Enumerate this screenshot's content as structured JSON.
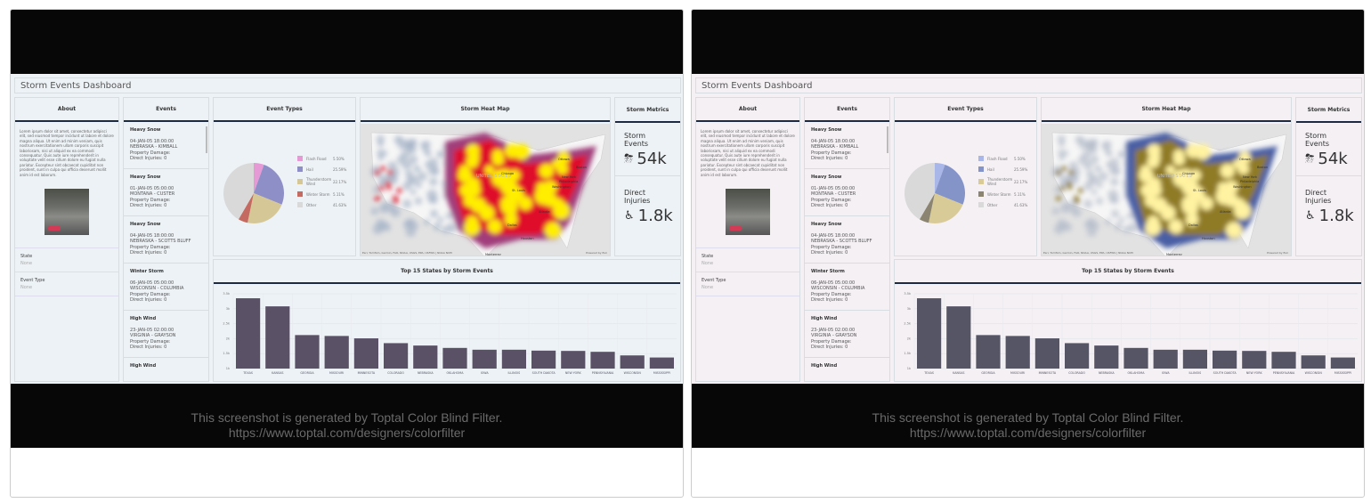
{
  "caption": {
    "line1": "This screenshot is generated by Toptal Color Blind Filter.",
    "line2": "https://www.toptal.com/designers/colorfilter"
  },
  "dashboard": {
    "title": "Storm Events Dashboard",
    "about": {
      "header": "About",
      "text": "Lorem ipsum dolor sit amet, consectetur adipisci elit, sed eiusmod tempor incidunt ut labore et dolore magna aliqua. Ut enim ad minim veniam, quis nostrum exercitationem ullam corporis suscipit laboriosam, nisi ut aliquid ex ea commodi consequatur. Quis aute iure reprehenderit in voluptate velit esse cillum dolore eu fugiat nulla pariatur. Excepteur sint obcaecat cupiditat non proident, sunt in culpa qui officia deserunt mollit anim id est laborum.",
      "state_label": "State",
      "state_value": "None",
      "type_label": "Event Type",
      "type_value": "None"
    },
    "events": {
      "header": "Events",
      "items": [
        {
          "type": "Heavy Snow",
          "date": "04-JAN-05 18:00:00",
          "loc": "NEBRASKA - KIMBALL",
          "damage": "Property Damage:",
          "injuries": "Direct Injuries: 0"
        },
        {
          "type": "Heavy Snow",
          "date": "01-JAN-05 05:00:00",
          "loc": "MONTANA - CUSTER",
          "damage": "Property Damage:",
          "injuries": "Direct Injuries: 0"
        },
        {
          "type": "Heavy Snow",
          "date": "04-JAN-05 18:00:00",
          "loc": "NEBRASKA - SCOTTS BLUFF",
          "damage": "Property Damage:",
          "injuries": "Direct Injuries: 0"
        },
        {
          "type": "Winter Storm",
          "date": "06-JAN-05 05:00:00",
          "loc": "WISCONSIN - COLUMBIA",
          "damage": "Property Damage:",
          "injuries": "Direct Injuries: 0"
        },
        {
          "type": "High Wind",
          "date": "23-JAN-05 02:00:00",
          "loc": "VIRGINIA - GRAYSON",
          "damage": "Property Damage:",
          "injuries": "Direct Injuries: 0"
        },
        {
          "type": "High Wind",
          "date": "",
          "loc": "",
          "damage": "",
          "injuries": ""
        }
      ]
    },
    "event_types": {
      "header": "Event Types",
      "slices": [
        {
          "label": "Flash Flood",
          "pct": "5.50%",
          "value": 5.5
        },
        {
          "label": "Hail",
          "pct": "25.59%",
          "value": 25.59
        },
        {
          "label": "Thunderstorm Wind",
          "pct": "22.17%",
          "value": 22.17
        },
        {
          "label": "Winter Storm",
          "pct": "5.11%",
          "value": 5.11
        },
        {
          "label": "Other",
          "pct": "41.63%",
          "value": 41.63
        }
      ]
    },
    "map": {
      "header": "Storm Heat Map",
      "attribution": "Esri, TomTom, Garmin, FAO, NOAA, USGS, EPA, USFWS | NOAA NCEI",
      "powered": "Powered by Esri",
      "labels": [
        "UNITED STATES",
        "Chicago",
        "St. Louis",
        "New York",
        "Philadelphia",
        "Washington",
        "Boston",
        "Ottawa",
        "Atlanta",
        "Dallas",
        "Houston",
        "Monterrey"
      ]
    },
    "metrics": {
      "header": "Storm Metrics",
      "events_label": "Storm Events",
      "events_value": "54k",
      "injuries_label": "Direct Injuries",
      "injuries_value": "1.8k"
    },
    "chart_data": {
      "type": "bar",
      "title": "Top 15 States by Storm Events",
      "categories": [
        "TEXAS",
        "KANSAS",
        "GEORGIA",
        "MISSOURI",
        "MINNESOTA",
        "COLORADO",
        "NEBRASKA",
        "OKLAHOMA",
        "IOWA",
        "ILLINOIS",
        "SOUTH DAKOTA",
        "NEW YORK",
        "PENNSYLVANIA",
        "WISCONSIN",
        "MISSISSIPPI"
      ],
      "values": [
        3350,
        3080,
        2120,
        2090,
        2010,
        1850,
        1770,
        1690,
        1630,
        1630,
        1600,
        1590,
        1560,
        1440,
        1370
      ],
      "ylim": [
        1000,
        3500
      ],
      "yticks": [
        {
          "v": 1000,
          "label": "1k"
        },
        {
          "v": 1500,
          "label": "1.5k"
        },
        {
          "v": 2000,
          "label": "2k"
        },
        {
          "v": 2500,
          "label": "2.5k"
        },
        {
          "v": 3000,
          "label": "3k"
        },
        {
          "v": 3500,
          "label": "3.5k"
        }
      ],
      "grid": true
    }
  },
  "variants": [
    {
      "bg": "#edf2f6",
      "bar": "#5a5166",
      "pie": [
        "#e59ad6",
        "#8f8fc8",
        "#d6c896",
        "#c56a60",
        "#d9d9d9"
      ],
      "heat": [
        "#a9b7c9",
        "#a03c7a",
        "#e0102a",
        "#ffee00"
      ]
    },
    {
      "bg": "#f4f0f4",
      "bar": "#565566",
      "pie": [
        "#a8b7e8",
        "#8494c8",
        "#d9cb98",
        "#8a8470",
        "#d9d9d9"
      ],
      "heat": [
        "#b8bfcc",
        "#4a5ea4",
        "#8f7a28",
        "#fff2a0"
      ]
    }
  ]
}
